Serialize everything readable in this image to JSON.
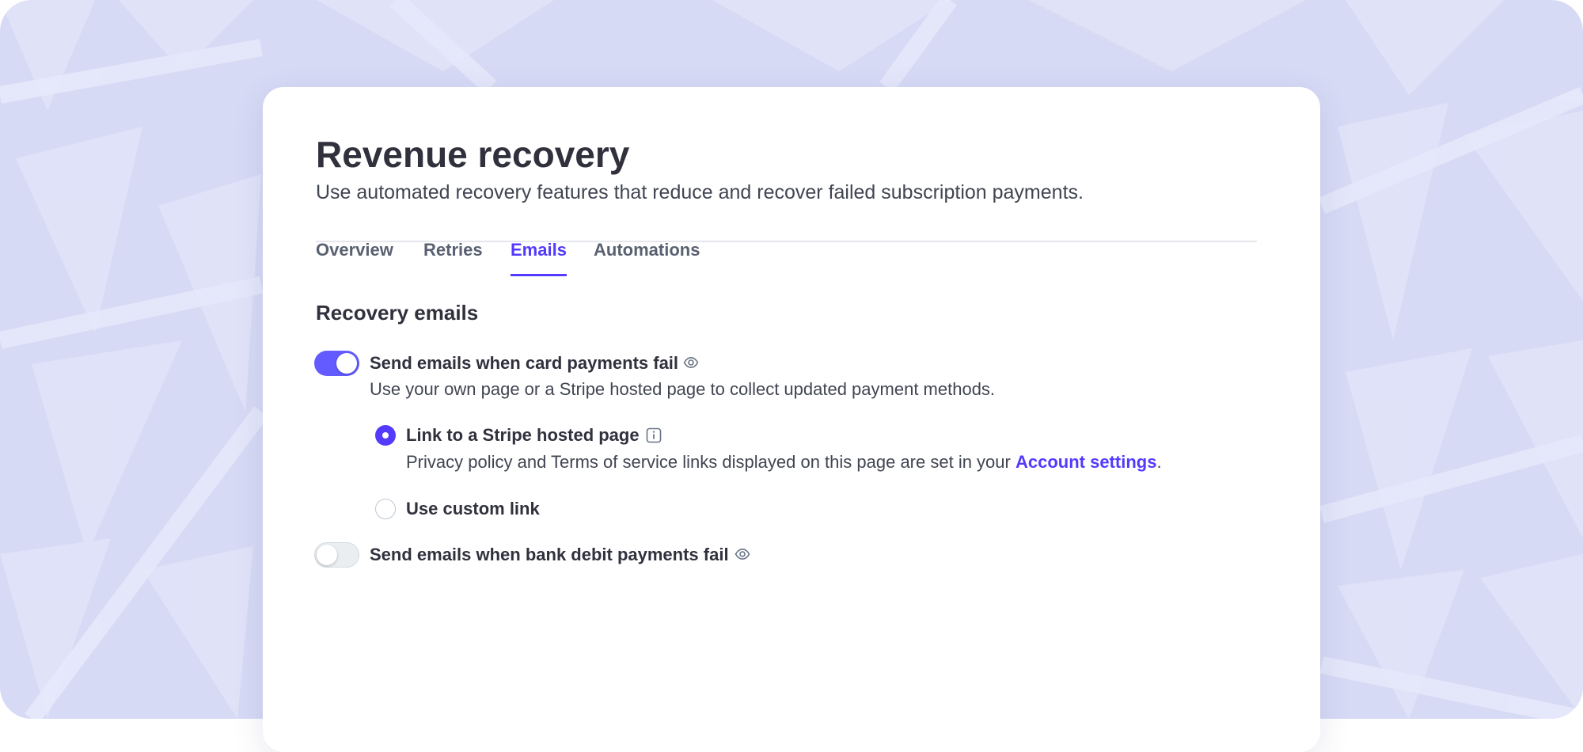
{
  "colors": {
    "accent": "#533afd",
    "toggle_on": "#635bff",
    "backdrop": "#d6daf5",
    "text_primary": "#30313d",
    "text_secondary": "#414552"
  },
  "header": {
    "title": "Revenue recovery",
    "subtitle": "Use automated recovery features that reduce and recover failed subscription payments."
  },
  "tabs": [
    {
      "label": "Overview",
      "active": false
    },
    {
      "label": "Retries",
      "active": false
    },
    {
      "label": "Emails",
      "active": true
    },
    {
      "label": "Automations",
      "active": false
    }
  ],
  "recovery_emails": {
    "title": "Recovery emails",
    "card_payments": {
      "enabled": true,
      "label": "Send emails when card payments fail",
      "icon": "eye-icon",
      "description": "Use your own page or a Stripe hosted page to collect updated payment methods.",
      "options": [
        {
          "label": "Link to a Stripe hosted page",
          "selected": true,
          "icon": "info-icon",
          "description_prefix": "Privacy policy and Terms of service links displayed on this page are set in your ",
          "link_text": "Account settings",
          "description_suffix": "."
        },
        {
          "label": "Use custom link",
          "selected": false
        }
      ]
    },
    "bank_debit": {
      "enabled": false,
      "label": "Send emails when bank debit payments fail",
      "icon": "eye-icon"
    }
  }
}
